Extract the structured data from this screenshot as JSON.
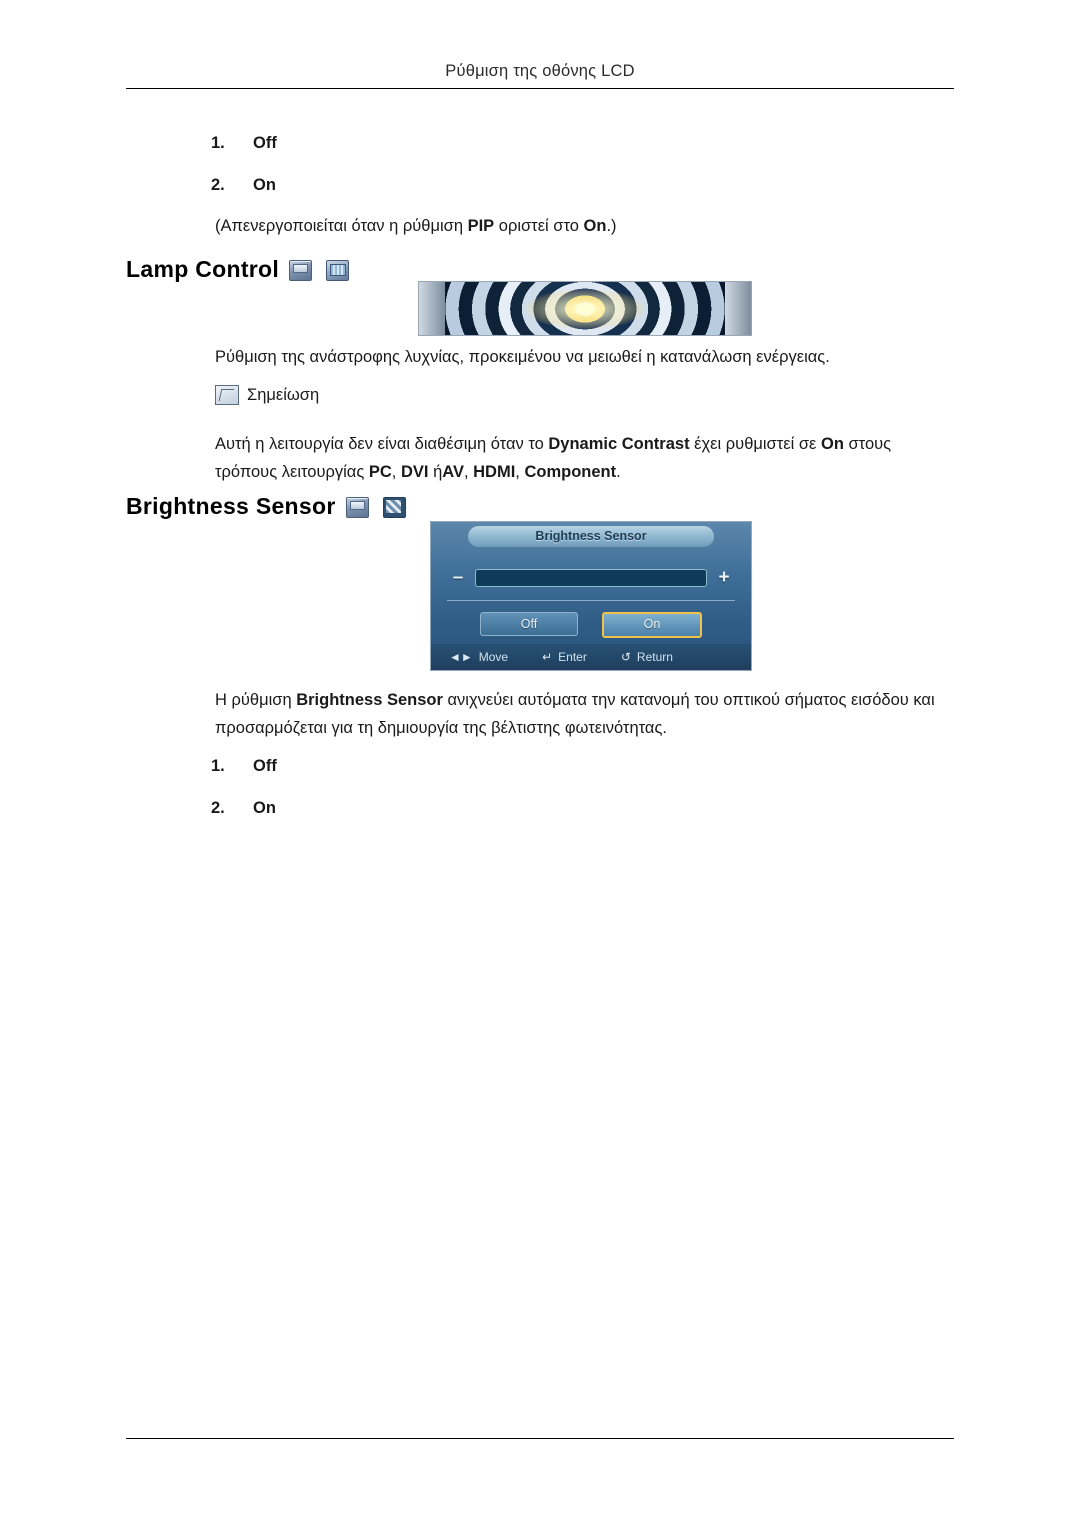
{
  "header": {
    "title": "Ρύθμιση της οθόνης LCD"
  },
  "top_list": {
    "items": [
      {
        "num": "1.",
        "label": "Off"
      },
      {
        "num": "2.",
        "label": "On"
      }
    ]
  },
  "pip_note": {
    "prefix": "(Απενεργοποιείται όταν η ρύθμιση ",
    "bold1": "PIP",
    "mid": " οριστεί στο ",
    "bold2": "On",
    "suffix": ".)"
  },
  "lamp_control": {
    "title": "Lamp Control",
    "icons": [
      "monitor-icon",
      "tv-icon"
    ],
    "description": "Ρύθμιση της ανάστροφης λυχνίας, προκειμένου να μειωθεί η κατανάλωση ενέργειας.",
    "note_label": "Σημείωση",
    "note_text_1": "Αυτή η λειτουργία δεν είναι διαθέσιμη όταν το ",
    "note_bold_1": "Dynamic Contrast",
    "note_text_2": " έχει ρυθμιστεί σε ",
    "note_bold_2": "On",
    "note_text_3": " στους τρόπους λειτουργίας ",
    "note_bold_3": "PC",
    "note_text_4": ", ",
    "note_bold_4": "DVI",
    "note_text_5": " ή",
    "note_bold_5": "AV",
    "note_text_6": ", ",
    "note_bold_6": "HDMI",
    "note_text_7": ", ",
    "note_bold_7": "Component",
    "note_text_8": "."
  },
  "brightness_sensor": {
    "title": "Brightness Sensor",
    "icons": [
      "monitor-icon",
      "mosaic-icon"
    ],
    "osd": {
      "title": "Brightness Sensor",
      "minus": "–",
      "plus": "+",
      "buttons": [
        {
          "label": "Off",
          "selected": false
        },
        {
          "label": "On",
          "selected": true
        }
      ],
      "footer": [
        {
          "glyph": "◄►",
          "label": "Move"
        },
        {
          "glyph": "↵",
          "label": "Enter"
        },
        {
          "glyph": "↺",
          "label": "Return"
        }
      ]
    },
    "description_1": "Η ρύθμιση ",
    "description_bold": "Brightness Sensor",
    "description_2": " ανιχνεύει αυτόματα την κατανομή του οπτικού σήματος εισόδου και προσαρμόζεται για τη δημιουργία της βέλτιστης φωτεινότητας.",
    "list": {
      "items": [
        {
          "num": "1.",
          "label": "Off"
        },
        {
          "num": "2.",
          "label": "On"
        }
      ]
    }
  }
}
